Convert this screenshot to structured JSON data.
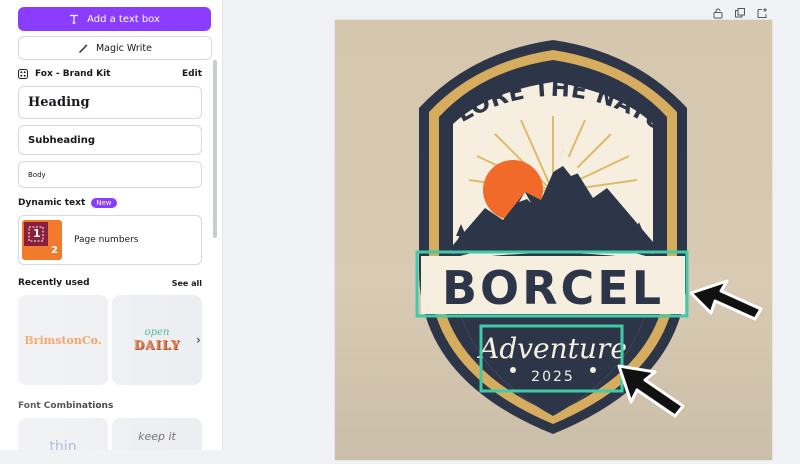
{
  "panel": {
    "add_text_box": "Add a text box",
    "magic_write": "Magic Write",
    "brand_kit": {
      "title": "Fox - Brand Kit",
      "edit": "Edit"
    },
    "styles": {
      "heading": "Heading",
      "subheading": "Subheading",
      "body": "Body"
    },
    "dynamic_text": {
      "title": "Dynamic text",
      "badge": "New",
      "page_numbers": "Page numbers",
      "thumb_numbers": [
        "1",
        "2"
      ]
    },
    "recently_used": {
      "title": "Recently used",
      "see_all": "See all",
      "items": [
        {
          "text": "BrimstonCo."
        },
        {
          "top": "open",
          "bottom": "DAILY"
        }
      ]
    },
    "font_combinations": {
      "title": "Font Combinations",
      "items": [
        "thin",
        "keep it"
      ]
    }
  },
  "badge": {
    "top_text": "EXPLORE THE NATURE",
    "brand": "BORCEL",
    "script": "Adventure",
    "year": "2025"
  },
  "colors": {
    "accent": "#8b3dff",
    "badge_navy": "#2d3648",
    "badge_gold": "#d6ac5e",
    "badge_cream": "#f6efe0",
    "sun": "#f26a2a",
    "highlight": "#3fcaa8",
    "canvas_bg": "#d5c6ae"
  },
  "icons": {
    "add_text_box": "text-t-icon",
    "magic_write": "magic-wand-icon",
    "brand_kit": "brand-kit-icon",
    "lock": "lock-icon",
    "duplicate": "duplicate-icon",
    "add_page": "add-page-icon",
    "chevron": "chevron-right-icon"
  }
}
